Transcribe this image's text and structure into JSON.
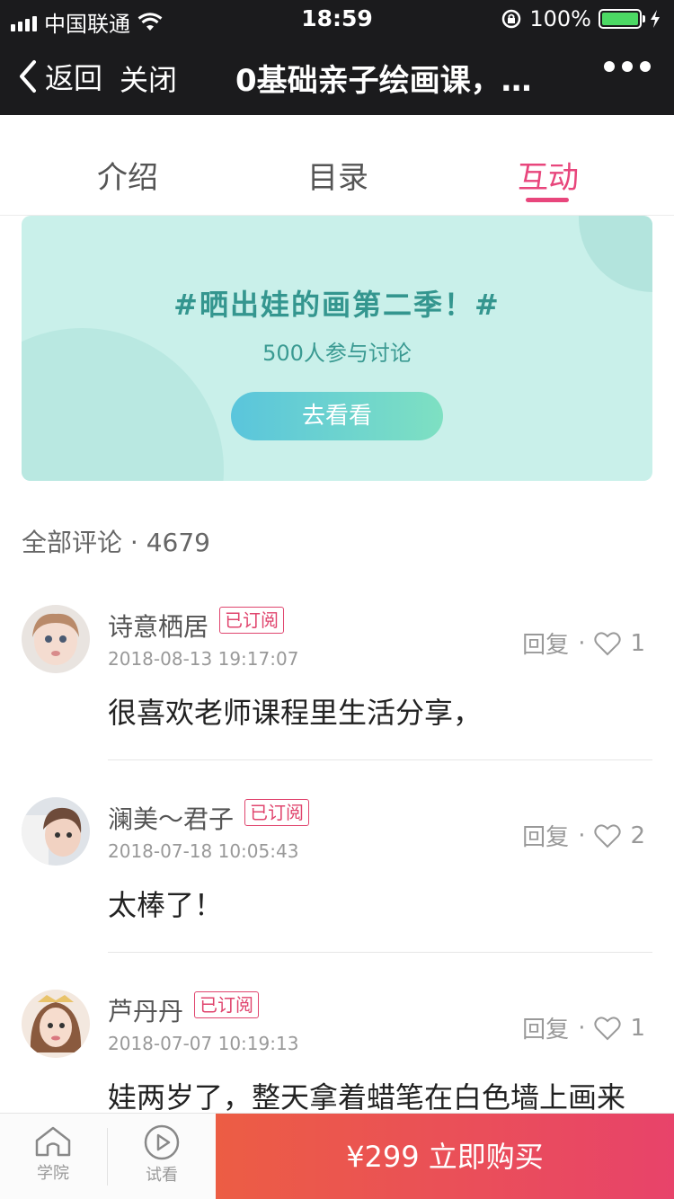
{
  "status_bar": {
    "carrier": "中国联通",
    "time": "18:59",
    "battery_percent": "100%"
  },
  "nav": {
    "back_label": "返回",
    "close_label": "关闭",
    "title": "0基础亲子绘画课，…"
  },
  "tabs": [
    {
      "label": "介绍"
    },
    {
      "label": "目录"
    },
    {
      "label": "互动",
      "active": true
    }
  ],
  "banner": {
    "title": "#晒出娃的画第二季！#",
    "subtitle": "500人参与讨论",
    "button_label": "去看看"
  },
  "comments_header": "全部评论 · 4679",
  "comments": [
    {
      "name": "诗意栖居",
      "badge": "已订阅",
      "time": "2018-08-13 19:17:07",
      "reply_label": "回复",
      "likes": "1",
      "text": "很喜欢老师课程里生活分享，"
    },
    {
      "name": "澜美～君子",
      "badge": "已订阅",
      "time": "2018-07-18 10:05:43",
      "reply_label": "回复",
      "likes": "2",
      "text": "太棒了！"
    },
    {
      "name": "芦丹丹",
      "badge": "已订阅",
      "time": "2018-07-07 10:19:13",
      "reply_label": "回复",
      "likes": "1",
      "text": "娃两岁了，整天拿着蜡笔在白色墙上画来"
    }
  ],
  "bottom_bar": {
    "home_label": "学院",
    "trial_label": "试看",
    "buy_label": "¥299 立即购买"
  },
  "colors": {
    "accent": "#e8467c",
    "banner_bg": "#c9f0ea",
    "buy_gradient_start": "#ec5d44",
    "buy_gradient_end": "#e8436a"
  }
}
